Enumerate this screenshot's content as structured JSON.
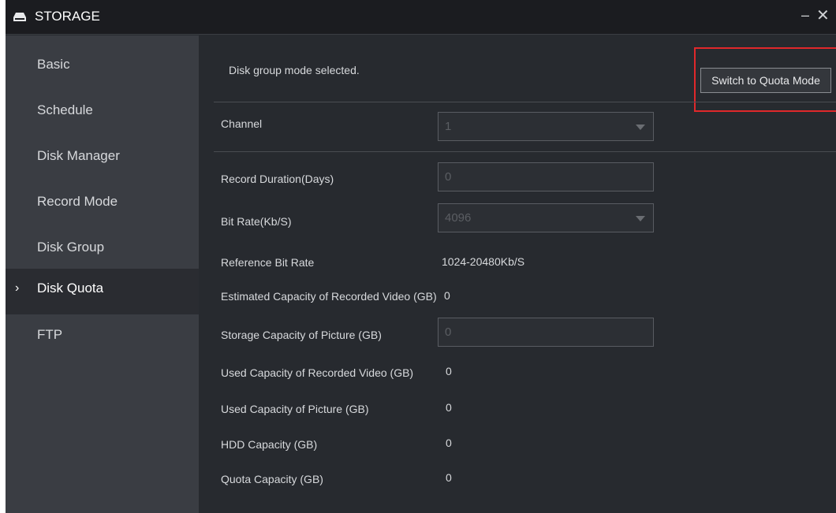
{
  "window": {
    "title": "STORAGE",
    "minimize_glyph": "–",
    "close_glyph": "✕"
  },
  "sidebar": {
    "items": [
      {
        "label": "Basic"
      },
      {
        "label": "Schedule"
      },
      {
        "label": "Disk Manager"
      },
      {
        "label": "Record Mode"
      },
      {
        "label": "Disk Group"
      },
      {
        "label": "Disk Quota",
        "active": true
      },
      {
        "label": "FTP"
      }
    ],
    "active_marker": "›"
  },
  "main": {
    "mode_text": "Disk group mode selected.",
    "switch_button": "Switch to Quota Mode",
    "channel": {
      "label": "Channel",
      "value": "1"
    },
    "record_duration": {
      "label": "Record Duration(Days)",
      "value": "0"
    },
    "bit_rate": {
      "label": "Bit Rate(Kb/S)",
      "value": "4096"
    },
    "reference_bit_rate": {
      "label": "Reference Bit Rate",
      "value": "1024-20480Kb/S"
    },
    "estimated_capacity": {
      "label": "Estimated Capacity of Recorded Video (GB)",
      "value": "0"
    },
    "picture_capacity": {
      "label": "Storage Capacity of Picture (GB)",
      "value": "0"
    },
    "used_video": {
      "label": "Used Capacity of Recorded Video (GB)",
      "value": "0"
    },
    "used_picture": {
      "label": "Used Capacity of Picture (GB)",
      "value": "0"
    },
    "hdd_capacity": {
      "label": "HDD Capacity (GB)",
      "value": "0"
    },
    "quota_capacity": {
      "label": "Quota Capacity (GB)",
      "value": "0"
    }
  },
  "colors": {
    "highlight": "#e0282b",
    "background": "#272a2f",
    "sidebar": "#3a3d43"
  }
}
